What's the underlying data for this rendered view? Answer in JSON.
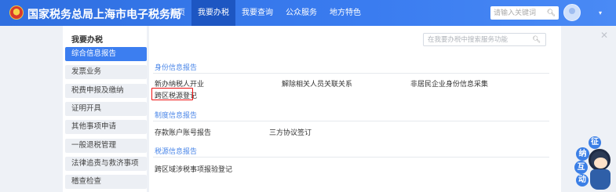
{
  "header": {
    "site_title": "国家税务总局上海市电子税务局",
    "nav": [
      "首页",
      "我要办税",
      "我要查询",
      "公众服务",
      "地方特色"
    ],
    "search_placeholder": "请输入关键词"
  },
  "sidebar": {
    "heading": "我要办税",
    "items": [
      "综合信息报告",
      "发票业务",
      "税费申报及缴纳",
      "证明开具",
      "其他事项申请",
      "一般退税管理",
      "法律追责与救济事项",
      "稽查检查"
    ]
  },
  "main": {
    "search_placeholder": "在我要办税中搜索服务功能",
    "sections": [
      {
        "title": "身份信息报告",
        "links": [
          "新办纳税人开业",
          "解除相关人员关联关系",
          "非居民企业身份信息采集",
          "跨区税源登记"
        ]
      },
      {
        "title": "制度信息报告",
        "links": [
          "存款账户账号报告",
          "三方协议签订"
        ]
      },
      {
        "title": "税源信息报告",
        "links": [
          "跨区域涉税事项报验登记"
        ]
      }
    ]
  },
  "mascot": {
    "chars": [
      "征",
      "纳",
      "互",
      "动"
    ]
  },
  "icons": {
    "search": "search-icon",
    "close": "close-icon",
    "caret": "chevron-down-icon",
    "emblem": "tax-emblem-icon"
  },
  "colors": {
    "accent": "#3c7ef0",
    "section": "#4a86e8",
    "highlight": "#ee1111"
  }
}
